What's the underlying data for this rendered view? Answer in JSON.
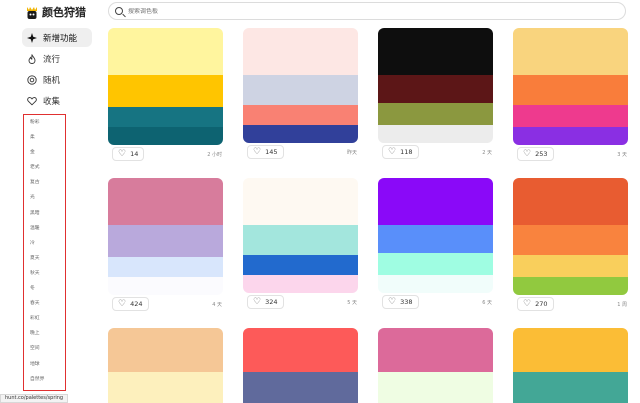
{
  "logo": {
    "text": "颜色狩猎"
  },
  "search": {
    "placeholder": "搜索调色板"
  },
  "nav": [
    {
      "label": "新增功能",
      "icon": "sparkle-icon"
    },
    {
      "label": "流行",
      "icon": "flame-icon"
    },
    {
      "label": "随机",
      "icon": "random-icon"
    },
    {
      "label": "收集",
      "icon": "heart-icon"
    }
  ],
  "tags": [
    "粉彩",
    "柔",
    "金",
    "老式",
    "复古",
    "光",
    "黑暗",
    "温暖",
    "冷",
    "夏天",
    "秋天",
    "冬",
    "春天",
    "彩虹",
    "晚上",
    "空间",
    "地球",
    "自然界"
  ],
  "status": "hunt.co/palettes/spring",
  "cards": [
    {
      "colors": [
        "#fff59e",
        "#ffc500",
        "#167482",
        "#0d6371"
      ],
      "likes": "14",
      "time": "2 小时"
    },
    {
      "colors": [
        "#fde7e4",
        "#ced3e3",
        "#f98173",
        "#31409a"
      ],
      "likes": "145",
      "time": "昨天"
    },
    {
      "colors": [
        "#0e0e0e",
        "#5c1617",
        "#8b983f",
        "#ececec"
      ],
      "likes": "118",
      "time": "2 天"
    },
    {
      "colors": [
        "#f9d47e",
        "#f97d3b",
        "#ee3a8e",
        "#8a2fe3"
      ],
      "likes": "253",
      "time": "3 天"
    },
    {
      "colors": [
        "#d77c9c",
        "#b9a9dc",
        "#d8e6fc",
        "#fbfbfe"
      ],
      "likes": "424",
      "time": "4 天"
    },
    {
      "colors": [
        "#fef9f2",
        "#a3e6dd",
        "#226ace",
        "#fcd6ec"
      ],
      "likes": "324",
      "time": "5 天"
    },
    {
      "colors": [
        "#8a09f8",
        "#598ffa",
        "#9ffde2",
        "#f1fdfb"
      ],
      "likes": "338",
      "time": "6 天"
    },
    {
      "colors": [
        "#e85c31",
        "#f9833e",
        "#f9cf5c",
        "#91c93f"
      ],
      "likes": "270",
      "time": "1 周"
    },
    {
      "colors": [
        "#f5c796",
        "#fdf0bd"
      ],
      "likes": "",
      "time": ""
    },
    {
      "colors": [
        "#fd5a59",
        "#606a9c"
      ],
      "likes": "",
      "time": ""
    },
    {
      "colors": [
        "#dc6a9a",
        "#effde3"
      ],
      "likes": "",
      "time": ""
    },
    {
      "colors": [
        "#fbbd36",
        "#43a796"
      ],
      "likes": "",
      "time": ""
    }
  ]
}
